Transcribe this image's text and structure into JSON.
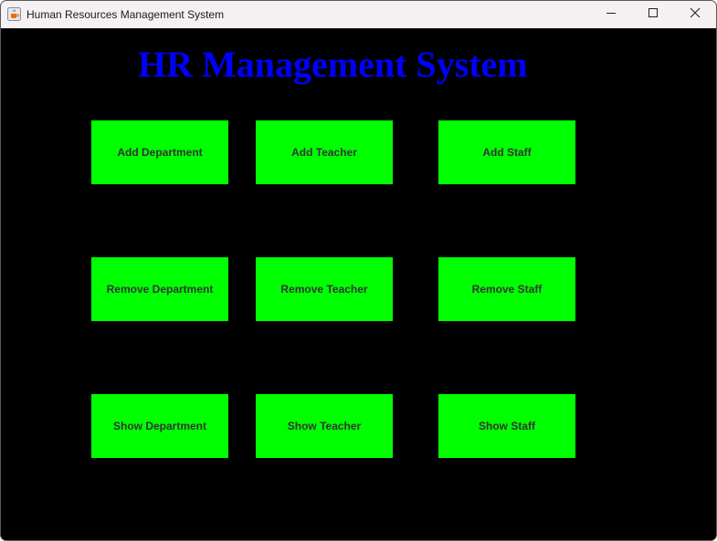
{
  "window": {
    "title": "Human Resources Management System",
    "app_icon": "java-cup-icon",
    "controls": {
      "minimize_icon": "minimize-icon",
      "maximize_icon": "maximize-icon",
      "close_icon": "close-icon"
    }
  },
  "heading": "HR Management System",
  "colors": {
    "background": "#000000",
    "heading": "#0000ff",
    "button_bg": "#00ff00",
    "button_text": "#333333"
  },
  "buttons": {
    "add_department": "Add Department",
    "add_teacher": "Add Teacher",
    "add_staff": "Add Staff",
    "remove_department": "Remove Department",
    "remove_teacher": "Remove Teacher",
    "remove_staff": "Remove Staff",
    "show_department": "Show Department",
    "show_teacher": "Show Teacher",
    "show_staff": "Show Staff"
  }
}
